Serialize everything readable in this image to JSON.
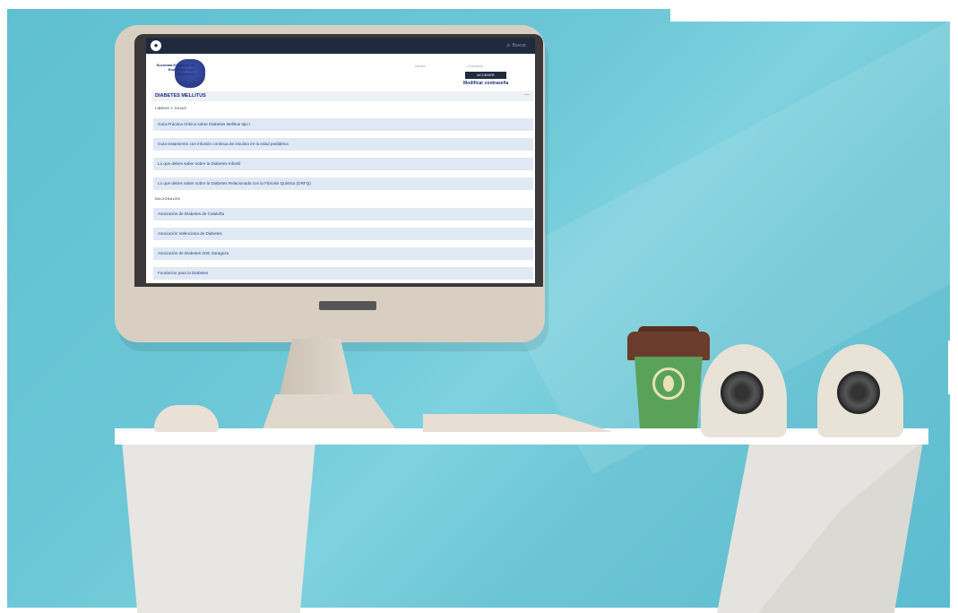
{
  "browser": {
    "search_placeholder": "Buscar"
  },
  "header": {
    "logo_text": "Sociedad Española de Endocrinología Pediátrica",
    "user_label": "Usuario",
    "password_label": "Contraseña",
    "login_button": "ACCEDER",
    "change_password_link": "Modificar contraseña"
  },
  "section": {
    "title": "DIABETES MELLITUS",
    "toggle": "—"
  },
  "groups": [
    {
      "label": "LIBROS Y GUIAS",
      "items": [
        "Guía Práctica Clínica sobre Diabetes Mellitus tipo I",
        "Guía tratamiento con infusión continua de insulina en la edad pediátrica",
        "Lo que debes saber sobre la Diabetes Infantil",
        "Lo que debes saber sobre la Diabetes Relacionada con la Fibrosis Quística (DRFQ)"
      ]
    },
    {
      "label": "NACIONALES",
      "items": [
        "Asociación de Diabetes de Cataluña",
        "Asociación Valenciana de Diabetes",
        "Asociación de Diabetes ADE Zaragoza",
        "Fundacion para la Diabetes"
      ]
    }
  ],
  "colors": {
    "wall": "#6cc7d6",
    "topbar": "#1f2b3d",
    "link_blue": "#1e2f7a",
    "item_bg": "#dfe9f4",
    "cup_green": "#5aa25a",
    "cup_lid": "#6b3b2b"
  },
  "icons": {
    "browser_logo": "twitter-bird-icon",
    "search": "search-icon"
  }
}
